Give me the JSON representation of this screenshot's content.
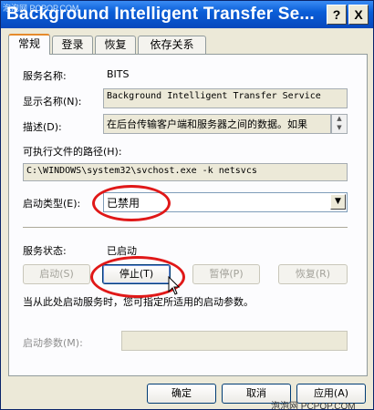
{
  "window": {
    "title": "Background Intelligent Transfer Se...",
    "help_btn": "?",
    "close_btn": "X"
  },
  "tabs": [
    {
      "label": "常规"
    },
    {
      "label": "登录"
    },
    {
      "label": "恢复"
    },
    {
      "label": "依存关系"
    }
  ],
  "general": {
    "service_name_label": "服务名称:",
    "service_name": "BITS",
    "display_name_label": "显示名称(N):",
    "display_name": "Background Intelligent Transfer Service",
    "description_label": "描述(D):",
    "description": "在后台传输客户端和服务器之间的数据。如果",
    "exe_path_label": "可执行文件的路径(H):",
    "exe_path": "C:\\WINDOWS\\system32\\svchost.exe -k netsvcs",
    "startup_type_label": "启动类型(E):",
    "startup_type": "已禁用",
    "status_label": "服务状态:",
    "status": "已启动",
    "buttons": {
      "start": "启动(S)",
      "stop": "停止(T)",
      "pause": "暂停(P)",
      "resume": "恢复(R)"
    },
    "hint": "当从此处启动服务时，您可指定所适用的启动参数。",
    "start_params_label": "启动参数(M):",
    "start_params_value": ""
  },
  "footer": {
    "ok": "确定",
    "cancel": "取消",
    "apply": "应用(A)"
  },
  "watermarks": {
    "top_left": "泡泡网 PCPOP.COM",
    "bottom_right": "泡泡网 PCPOP.COM"
  },
  "colors": {
    "title_bar": "#0a5ed8",
    "highlight_circle": "#e01818",
    "active_tab_accent": "#e68b2c"
  }
}
